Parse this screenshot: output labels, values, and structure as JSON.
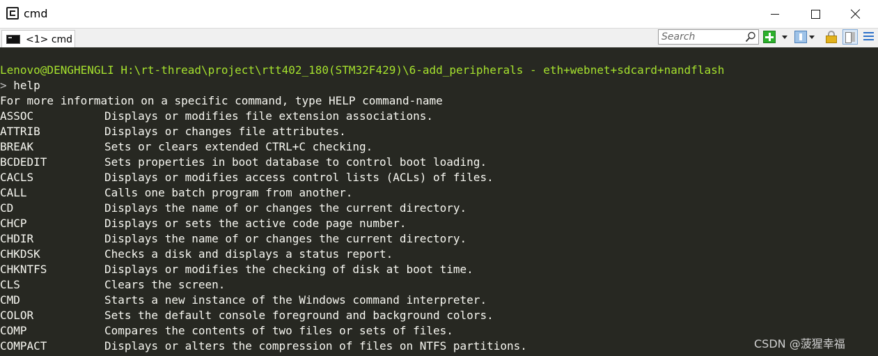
{
  "window": {
    "title": "cmd",
    "icon": "console-app-icon"
  },
  "tab": {
    "label": "<1> cmd",
    "icon": "console-icon"
  },
  "search": {
    "placeholder": "Search"
  },
  "toolbar": {
    "icons": [
      "new-console-icon",
      "dropdown-icon",
      "panel-icon",
      "dropdown-icon",
      "lock-icon",
      "split-view-icon",
      "menu-icon"
    ]
  },
  "terminal": {
    "prompt": "Lenovo@DENGHENGLI H:\\rt-thread\\project\\rtt402_180(STM32F429)\\6-add_peripherals - eth+webnet+sdcard+nandflash",
    "input_caret": ">",
    "input_command": "help",
    "info_line": "For more information on a specific command, type HELP command-name",
    "commands": [
      {
        "name": "ASSOC",
        "desc": "Displays or modifies file extension associations."
      },
      {
        "name": "ATTRIB",
        "desc": "Displays or changes file attributes."
      },
      {
        "name": "BREAK",
        "desc": "Sets or clears extended CTRL+C checking."
      },
      {
        "name": "BCDEDIT",
        "desc": "Sets properties in boot database to control boot loading."
      },
      {
        "name": "CACLS",
        "desc": "Displays or modifies access control lists (ACLs) of files."
      },
      {
        "name": "CALL",
        "desc": "Calls one batch program from another."
      },
      {
        "name": "CD",
        "desc": "Displays the name of or changes the current directory."
      },
      {
        "name": "CHCP",
        "desc": "Displays or sets the active code page number."
      },
      {
        "name": "CHDIR",
        "desc": "Displays the name of or changes the current directory."
      },
      {
        "name": "CHKDSK",
        "desc": "Checks a disk and displays a status report."
      },
      {
        "name": "CHKNTFS",
        "desc": "Displays or modifies the checking of disk at boot time."
      },
      {
        "name": "CLS",
        "desc": "Clears the screen."
      },
      {
        "name": "CMD",
        "desc": "Starts a new instance of the Windows command interpreter."
      },
      {
        "name": "COLOR",
        "desc": "Sets the default console foreground and background colors."
      },
      {
        "name": "COMP",
        "desc": "Compares the contents of two files or sets of files."
      },
      {
        "name": "COMPACT",
        "desc": "Displays or alters the compression of files on NTFS partitions."
      }
    ]
  },
  "watermark": "CSDN @菠猩幸福",
  "colors": {
    "terminal_bg": "#272822",
    "terminal_fg": "#f8f8f2",
    "prompt_green": "#a6e22e"
  }
}
